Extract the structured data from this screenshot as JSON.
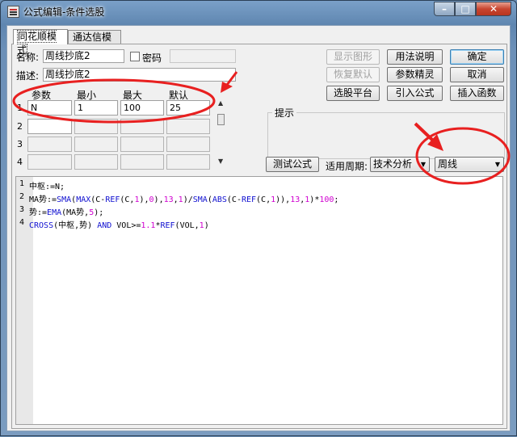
{
  "window": {
    "title": "公式编辑-条件选股"
  },
  "caption": {
    "minimize": "–",
    "maximize": "□",
    "close": "✕"
  },
  "tabs": [
    "同花顺模式",
    "通达信模式"
  ],
  "form": {
    "name_label": "名称:",
    "name_value": "周线抄底2",
    "password_label": "密码",
    "desc_label": "描述:",
    "desc_value": "周线抄底2"
  },
  "buttons": {
    "show_graph": "显示图形",
    "restore_default": "恢复默认",
    "select_platform": "选股平台",
    "usage": "用法说明",
    "param_wizard": "参数精灵",
    "import_formula": "引入公式",
    "ok": "确定",
    "cancel": "取消",
    "insert_function": "插入函数",
    "test_formula": "测试公式"
  },
  "params": {
    "headers": [
      "参数",
      "最小",
      "最大",
      "默认"
    ],
    "rows": [
      {
        "num": "1",
        "name": "N",
        "min": "1",
        "max": "100",
        "default": "25"
      },
      {
        "num": "2"
      },
      {
        "num": "3"
      },
      {
        "num": "4"
      }
    ]
  },
  "hint": {
    "title": "提示"
  },
  "period": {
    "label": "适用周期:",
    "analysis": "技术分析",
    "cycle": "周线"
  },
  "code": [
    {
      "num": "1",
      "segments": [
        {
          "t": "中枢:=N;",
          "c": ""
        }
      ]
    },
    {
      "num": "2",
      "segments": [
        {
          "t": "MA势:=",
          "c": ""
        },
        {
          "t": "SMA",
          "c": "kw"
        },
        {
          "t": "(",
          "c": ""
        },
        {
          "t": "MAX",
          "c": "kw"
        },
        {
          "t": "(C-",
          "c": ""
        },
        {
          "t": "REF",
          "c": "kw"
        },
        {
          "t": "(C,",
          "c": ""
        },
        {
          "t": "1",
          "c": "num"
        },
        {
          "t": "),",
          "c": ""
        },
        {
          "t": "0",
          "c": "num"
        },
        {
          "t": "),",
          "c": ""
        },
        {
          "t": "13",
          "c": "num"
        },
        {
          "t": ",",
          "c": ""
        },
        {
          "t": "1",
          "c": "num"
        },
        {
          "t": ")/",
          "c": ""
        },
        {
          "t": "SMA",
          "c": "kw"
        },
        {
          "t": "(",
          "c": ""
        },
        {
          "t": "ABS",
          "c": "kw"
        },
        {
          "t": "(C-",
          "c": ""
        },
        {
          "t": "REF",
          "c": "kw"
        },
        {
          "t": "(C,",
          "c": ""
        },
        {
          "t": "1",
          "c": "num"
        },
        {
          "t": ")),",
          "c": ""
        },
        {
          "t": "13",
          "c": "num"
        },
        {
          "t": ",",
          "c": ""
        },
        {
          "t": "1",
          "c": "num"
        },
        {
          "t": ")*",
          "c": ""
        },
        {
          "t": "100",
          "c": "num"
        },
        {
          "t": ";",
          "c": ""
        }
      ]
    },
    {
      "num": "3",
      "segments": [
        {
          "t": "势:=",
          "c": ""
        },
        {
          "t": "EMA",
          "c": "kw"
        },
        {
          "t": "(MA势,",
          "c": ""
        },
        {
          "t": "5",
          "c": "num"
        },
        {
          "t": ");",
          "c": ""
        }
      ]
    },
    {
      "num": "4",
      "segments": [
        {
          "t": "CROSS",
          "c": "kw"
        },
        {
          "t": "(中枢,势) ",
          "c": ""
        },
        {
          "t": "AND",
          "c": "kw"
        },
        {
          "t": " VOL>=",
          "c": ""
        },
        {
          "t": "1.1",
          "c": "num"
        },
        {
          "t": "*",
          "c": ""
        },
        {
          "t": "REF",
          "c": "kw"
        },
        {
          "t": "(VOL,",
          "c": ""
        },
        {
          "t": "1",
          "c": "num"
        },
        {
          "t": ")",
          "c": ""
        }
      ]
    }
  ],
  "annotation_color": "#e82020"
}
